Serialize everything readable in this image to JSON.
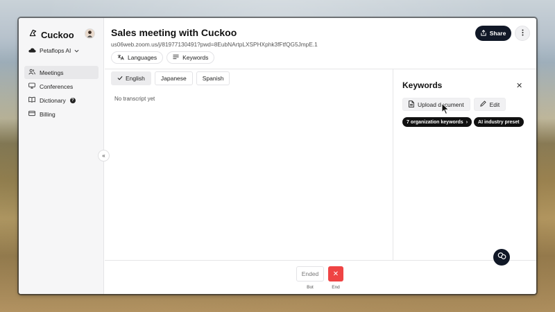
{
  "app": {
    "name": "Cuckoo"
  },
  "org": {
    "name": "Petaflops AI"
  },
  "sidebar": {
    "items": [
      {
        "label": "Meetings",
        "icon": "users-icon",
        "active": true
      },
      {
        "label": "Conferences",
        "icon": "monitor-icon"
      },
      {
        "label": "Dictionary",
        "icon": "book-icon",
        "badge": "?"
      },
      {
        "label": "Billing",
        "icon": "credit-card-icon"
      }
    ],
    "collapse_glyph": "«"
  },
  "meeting": {
    "title": "Sales meeting with Cuckoo",
    "url": "us06web.zoom.us/j/81977130491?pwd=8EubNArtpLXSPHXphk3fFtfQG5JmpE.1"
  },
  "header": {
    "languages_label": "Languages",
    "keywords_label": "Keywords",
    "share_label": "Share"
  },
  "transcript": {
    "tabs": [
      {
        "label": "English",
        "active": true
      },
      {
        "label": "Japanese"
      },
      {
        "label": "Spanish"
      }
    ],
    "empty_text": "No transcript yet"
  },
  "keywords_panel": {
    "title": "Keywords",
    "close_glyph": "✕",
    "upload_label": "Upload document",
    "edit_label": "Edit",
    "tags": [
      {
        "label": "7 organization keywords",
        "chevron": "›"
      },
      {
        "label": "AI industry preset"
      }
    ]
  },
  "controls": {
    "ended_label": "Ended",
    "bot_label": "Bot",
    "end_glyph": "✕",
    "end_label": "End"
  },
  "colors": {
    "primary_dark": "#111827",
    "danger": "#ef4444",
    "sidebar_bg": "#f6f6f7"
  }
}
